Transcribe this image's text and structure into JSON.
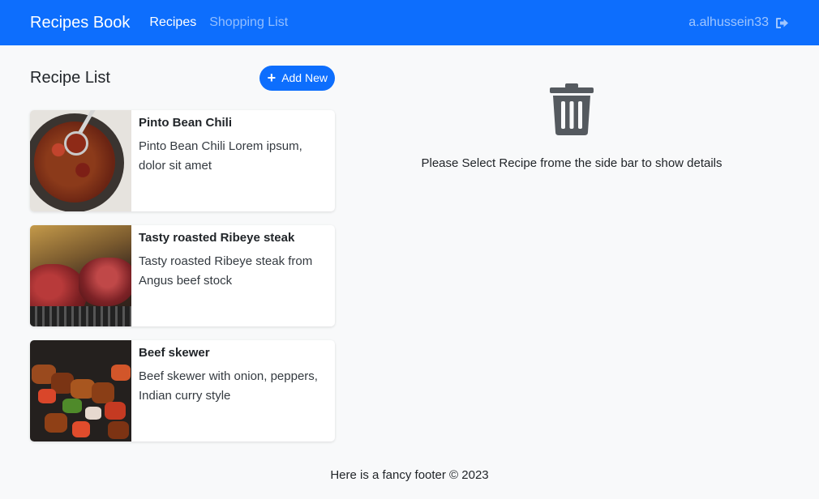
{
  "navbar": {
    "brand": "Recipes Book",
    "links": [
      {
        "label": "Recipes",
        "active": true
      },
      {
        "label": "Shopping List",
        "active": false
      }
    ],
    "username": "a.alhussein33",
    "logout_icon": "sign-out-icon",
    "bg_color": "#0d6efd"
  },
  "sidebar": {
    "title": "Recipe List",
    "add_button_label": "Add New",
    "add_icon": "plus-icon",
    "recipes": [
      {
        "name": "Pinto Bean Chili",
        "description": "Pinto Bean Chili Lorem ipsum, dolor sit amet",
        "image": "chili-pot-image"
      },
      {
        "name": "Tasty roasted Ribeye steak",
        "description": "Tasty roasted Ribeye steak from Angus beef stock",
        "image": "ribeye-steak-image"
      },
      {
        "name": "Beef skewer",
        "description": "Beef skewer with onion, peppers, Indian curry style",
        "image": "beef-skewer-image"
      }
    ]
  },
  "detail": {
    "icon": "trash-icon",
    "message": "Please Select Recipe frome the side bar to show details"
  },
  "footer": {
    "text": "Here is a fancy footer © 2023"
  }
}
